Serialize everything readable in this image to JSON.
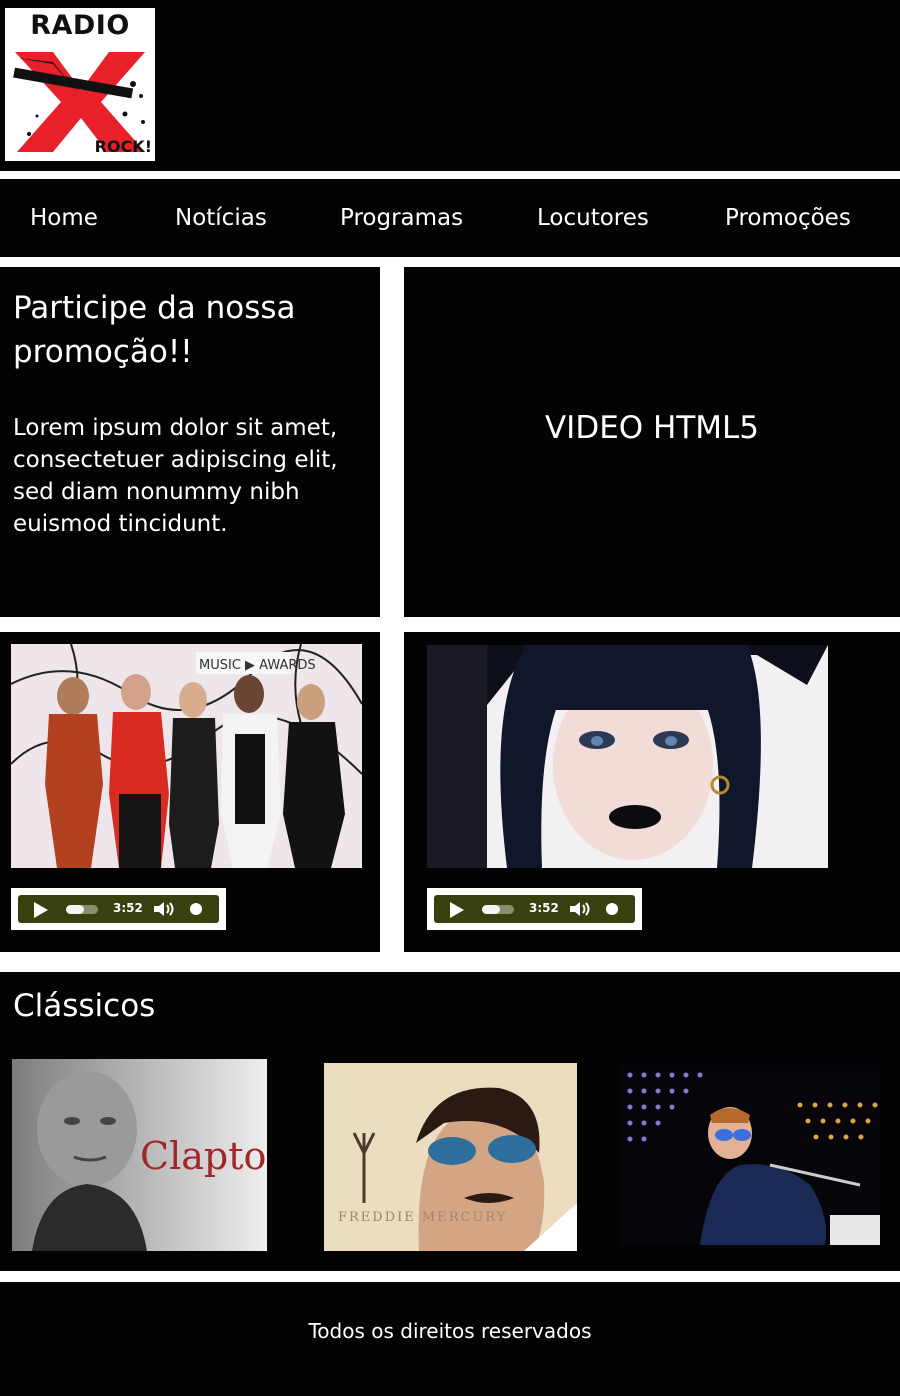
{
  "logo": {
    "top_text": "RADIO",
    "letter": "X",
    "bottom_text": "ROCK!",
    "accent_color": "#e8202a"
  },
  "nav": {
    "items": [
      {
        "label": "Home"
      },
      {
        "label": "Notícias"
      },
      {
        "label": "Programas"
      },
      {
        "label": "Locutores"
      },
      {
        "label": "Promoções"
      }
    ]
  },
  "promo": {
    "title": "Participe da nossa promoção!!",
    "text": "Lorem ipsum dolor sit amet, consectetuer adipiscing elit, sed diam nonummy nibh euismod tincidunt."
  },
  "video": {
    "label": "VIDEO HTML5"
  },
  "players": [
    {
      "time": "3:52",
      "progress": 0.55
    },
    {
      "time": "3:52",
      "progress": 0.55
    }
  ],
  "classics": {
    "title": "Clássicos",
    "items": [
      {
        "caption": "Clapton"
      },
      {
        "caption": "FREDDIE MERCURY"
      },
      {
        "caption": ""
      }
    ]
  },
  "footer": {
    "text": "Todos os direitos reservados"
  },
  "colors": {
    "background": "#030303",
    "separator": "#ffffff",
    "player": "#39400f"
  }
}
